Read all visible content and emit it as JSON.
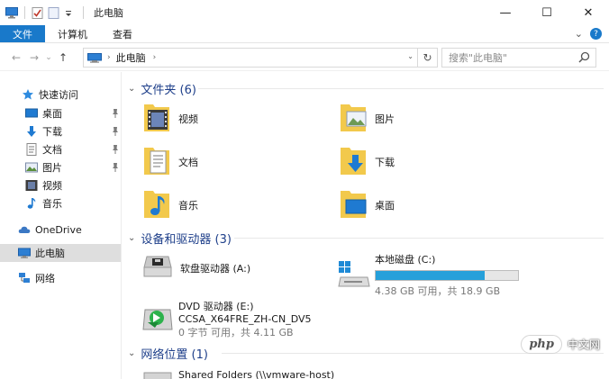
{
  "window": {
    "title": "此电脑",
    "minimize": "—",
    "maximize": "☐",
    "close": "✕"
  },
  "ribbon": {
    "tabs": [
      {
        "label": "文件",
        "active": true
      },
      {
        "label": "计算机",
        "active": false
      },
      {
        "label": "查看",
        "active": false
      }
    ],
    "expand": "⌄",
    "help": "?"
  },
  "address": {
    "back": "←",
    "forward": "→",
    "recent": "⌄",
    "up": "↑",
    "crumb": "此电脑",
    "chevron": "›",
    "dropdown": "⌄",
    "refresh": "↻"
  },
  "search": {
    "placeholder": "搜索\"此电脑\""
  },
  "sidebar": {
    "quick_access": "快速访问",
    "quick_items": [
      {
        "label": "桌面",
        "icon": "desktop-icon",
        "pinned": true
      },
      {
        "label": "下载",
        "icon": "download-arrow-icon",
        "pinned": true
      },
      {
        "label": "文档",
        "icon": "document-icon",
        "pinned": true
      },
      {
        "label": "图片",
        "icon": "picture-icon",
        "pinned": true
      },
      {
        "label": "视频",
        "icon": "video-icon",
        "pinned": false
      },
      {
        "label": "音乐",
        "icon": "music-note-icon",
        "pinned": false
      }
    ],
    "onedrive": "OneDrive",
    "this_pc": "此电脑",
    "network": "网络"
  },
  "content": {
    "folders_header": "文件夹 (6)",
    "folders": [
      {
        "label": "视频",
        "icon": "video-folder-icon"
      },
      {
        "label": "图片",
        "icon": "picture-folder-icon"
      },
      {
        "label": "文档",
        "icon": "document-folder-icon"
      },
      {
        "label": "下载",
        "icon": "download-folder-icon"
      },
      {
        "label": "音乐",
        "icon": "music-folder-icon"
      },
      {
        "label": "桌面",
        "icon": "desktop-folder-icon"
      }
    ],
    "devices_header": "设备和驱动器 (3)",
    "floppy": {
      "label": "软盘驱动器 (A:)"
    },
    "local_disk": {
      "label": "本地磁盘 (C:)",
      "free": "4.38 GB 可用，共 18.9 GB",
      "used_fraction": 0.768
    },
    "dvd": {
      "label": "DVD 驱动器 (E:)",
      "volume": "CCSA_X64FRE_ZH-CN_DV5",
      "free": "0 字节 可用，共 4.11 GB"
    },
    "network_header": "网络位置 (1)",
    "network_item": "Shared Folders (\\\\vmware-host)"
  },
  "watermark": {
    "badge": "php",
    "text": "中文网"
  },
  "colors": {
    "accent": "#1979ca",
    "header_text": "#1e3f8a",
    "folder_yellow": "#f2c94c",
    "bar_fill": "#26a0da"
  }
}
